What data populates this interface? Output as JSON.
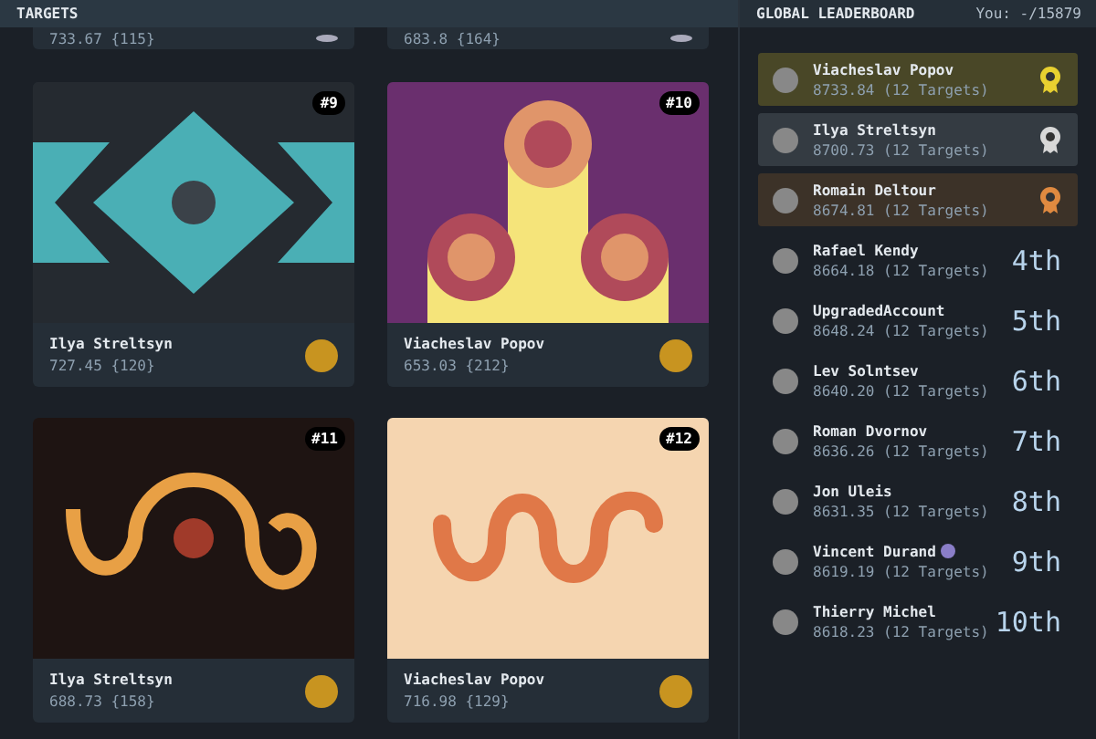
{
  "targets": {
    "title": "TARGETS",
    "cut_cards": [
      {
        "score": "733.67 {115}"
      },
      {
        "score": "683.8 {164}"
      }
    ],
    "cards": [
      {
        "number": "#9",
        "kind": "diamonds",
        "name": "Ilya Streltsyn",
        "score": "727.45 {120}"
      },
      {
        "number": "#10",
        "kind": "pillars",
        "name": "Viacheslav Popov",
        "score": "653.03 {212}"
      },
      {
        "number": "#11",
        "kind": "squiggle",
        "name": "Ilya Streltsyn",
        "score": "688.73 {158}"
      },
      {
        "number": "#12",
        "kind": "wave",
        "name": "Viacheslav Popov",
        "score": "716.98 {129}"
      }
    ]
  },
  "leaderboard": {
    "title": "GLOBAL LEADERBOARD",
    "you": "You: -/15879",
    "entries": [
      {
        "kind": "medal",
        "color": "#e8d030",
        "name": "Viacheslav Popov",
        "score": "8733.84 (12 Targets)"
      },
      {
        "kind": "medal",
        "color": "#d8d8d8",
        "name": "Ilya Streltsyn",
        "score": "8700.73 (12 Targets)"
      },
      {
        "kind": "medal",
        "color": "#e08a40",
        "name": "Romain Deltour",
        "score": "8674.81 (12 Targets)"
      },
      {
        "kind": "rank",
        "rank": "4th",
        "name": "Rafael Kendy",
        "score": "8664.18 (12 Targets)"
      },
      {
        "kind": "rank",
        "rank": "5th",
        "name": "UpgradedAccount",
        "score": "8648.24 (12 Targets)"
      },
      {
        "kind": "rank",
        "rank": "6th",
        "name": "Lev Solntsev",
        "score": "8640.20 (12 Targets)"
      },
      {
        "kind": "rank",
        "rank": "7th",
        "name": "Roman Dvornov",
        "score": "8636.26 (12 Targets)"
      },
      {
        "kind": "rank",
        "rank": "8th",
        "name": "Jon Uleis",
        "score": "8631.35 (12 Targets)"
      },
      {
        "kind": "rank",
        "rank": "9th",
        "name": "Vincent Durand",
        "badge": true,
        "score": "8619.19 (12 Targets)"
      },
      {
        "kind": "rank",
        "rank": "10th",
        "name": "Thierry Michel",
        "score": "8618.23 (12 Targets)"
      }
    ]
  }
}
